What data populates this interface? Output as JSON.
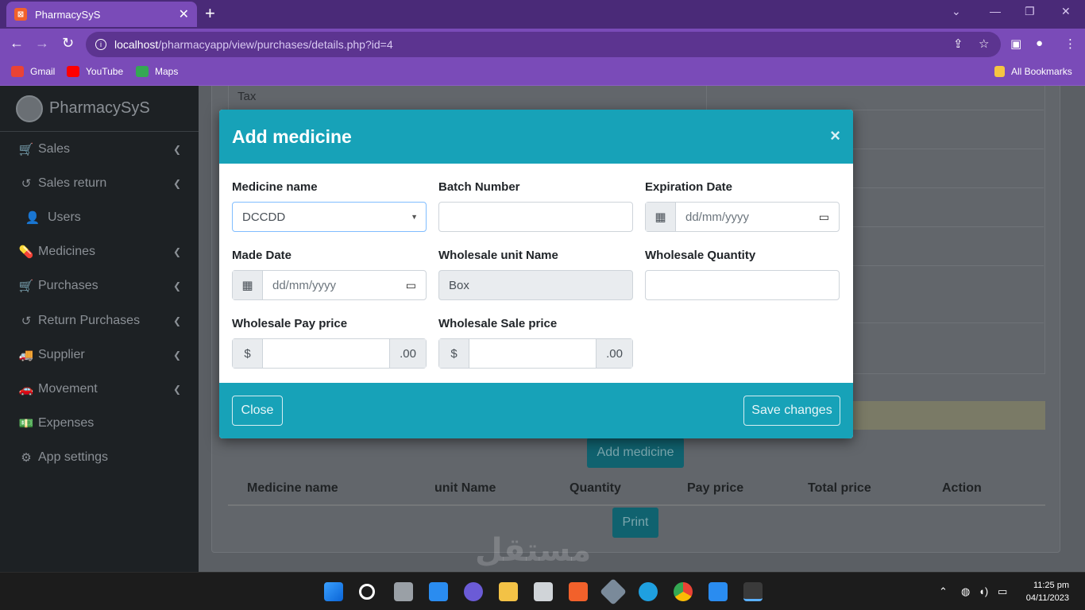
{
  "browser": {
    "tab_title": "PharmacySyS",
    "tab_close": "✕",
    "new_tab": "+",
    "url_host": "localhost",
    "url_path": "/pharmacyapp/view/purchases/details.php?id=4",
    "bookmarks": [
      {
        "label": "Gmail",
        "color": "#ea4335"
      },
      {
        "label": "YouTube",
        "color": "#ff0000"
      },
      {
        "label": "Maps",
        "color": "#34a853"
      }
    ],
    "all_bookmarks": "All Bookmarks"
  },
  "sidebar": {
    "brand": "PharmacySyS",
    "items": [
      {
        "label": "Sales",
        "icon": "cart-icon",
        "glyph": "🛒",
        "chevron": true
      },
      {
        "label": "Sales return",
        "icon": "undo-icon",
        "glyph": "↺",
        "chevron": true
      },
      {
        "label": "Users",
        "icon": "user-icon",
        "glyph": "👤",
        "chevron": false
      },
      {
        "label": "Medicines",
        "icon": "pills-icon",
        "glyph": "💊",
        "chevron": true
      },
      {
        "label": "Purchases",
        "icon": "cart-icon",
        "glyph": "🛒",
        "chevron": true
      },
      {
        "label": "Return Purchases",
        "icon": "undo-icon",
        "glyph": "↺",
        "chevron": true
      },
      {
        "label": "Supplier",
        "icon": "truck-icon",
        "glyph": "🚚",
        "chevron": true
      },
      {
        "label": "Movement",
        "icon": "car-icon",
        "glyph": "🚗",
        "chevron": true
      },
      {
        "label": "Expenses",
        "icon": "money-icon",
        "glyph": "💵",
        "chevron": false
      },
      {
        "label": "App settings",
        "icon": "gear-icon",
        "glyph": "⚙",
        "chevron": false
      }
    ]
  },
  "background": {
    "tax_label": "Tax",
    "add_medicine_button": "Add medicine",
    "print_button": "Print",
    "table_headers": [
      "Medicine name",
      "unit Name",
      "Quantity",
      "Pay price",
      "Total price",
      "Action"
    ]
  },
  "modal": {
    "title": "Add medicine",
    "close_x": "×",
    "fields": {
      "medicine_name": {
        "label": "Medicine name",
        "value": "DCCDD"
      },
      "batch_number": {
        "label": "Batch Number",
        "value": ""
      },
      "expiration_date": {
        "label": "Expiration Date",
        "placeholder": "dd/mm/yyyy"
      },
      "made_date": {
        "label": "Made Date",
        "placeholder": "dd/mm/yyyy"
      },
      "wholesale_unit_name": {
        "label": "Wholesale unit Name",
        "value": "Box"
      },
      "wholesale_quantity": {
        "label": "Wholesale Quantity",
        "value": ""
      },
      "wholesale_pay_price": {
        "label": "Wholesale Pay price",
        "prefix": "$",
        "suffix": ".00",
        "value": ""
      },
      "wholesale_sale_price": {
        "label": "Wholesale Sale price",
        "prefix": "$",
        "suffix": ".00",
        "value": ""
      }
    },
    "close_button": "Close",
    "save_button": "Save changes"
  },
  "taskbar": {
    "time": "11:25 pm",
    "date": "04/11/2023"
  },
  "watermark": "مستقل"
}
